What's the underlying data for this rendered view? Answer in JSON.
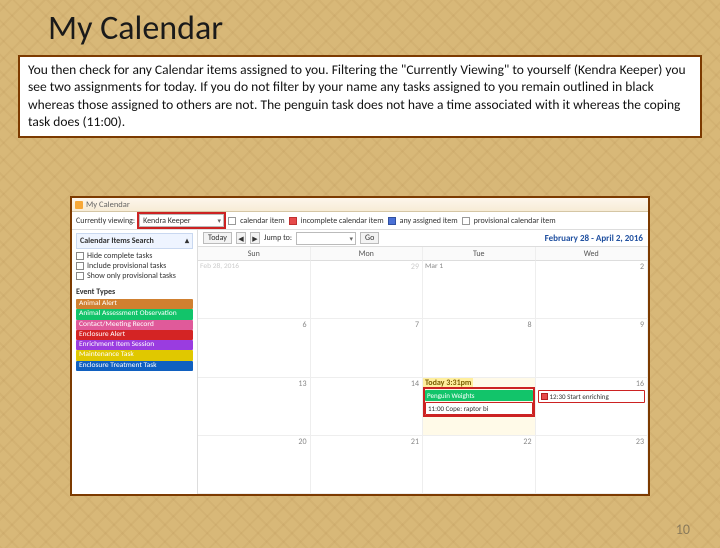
{
  "page": {
    "title": "My Calendar",
    "description": "You then check for any Calendar items assigned to you. Filtering the \"Currently Viewing\" to yourself (Kendra Keeper) you see two assignments for today. If you do not filter by your name any tasks assigned to you remain outlined in black whereas those assigned to others are not. The penguin task does not have a time associated with it whereas the coping task does (11:00).",
    "page_number": "10"
  },
  "app": {
    "window_title": "My Calendar",
    "toolbar": {
      "viewing_label": "Currently viewing:",
      "viewing_value": "Kendra Keeper",
      "legend": [
        {
          "label": "calendar item"
        },
        {
          "label": "incomplete calendar item"
        },
        {
          "label": "any assigned item"
        },
        {
          "label": "provisional calendar item"
        }
      ]
    },
    "controls": {
      "today": "Today",
      "jump_to": "Jump to:",
      "go": "Go",
      "date_range": "February 28 - April 2, 2016"
    },
    "sidebar": {
      "header": "Calendar Items Search",
      "checks": [
        "Hide complete tasks",
        "Include provisional tasks",
        "Show only provisional tasks"
      ],
      "event_types_label": "Event Types",
      "event_types": [
        {
          "label": "Animal Alert",
          "color": "#d08030"
        },
        {
          "label": "Animal Assessment Observation",
          "color": "#12c46a"
        },
        {
          "label": "Contact/Meeting Record",
          "color": "#e05a9a"
        },
        {
          "label": "Enclosure Alert",
          "color": "#d42424"
        },
        {
          "label": "Enrichment Item Session",
          "color": "#9a3ce0"
        },
        {
          "label": "Maintenance Task",
          "color": "#e0c800"
        },
        {
          "label": "Enclosure Treatment Task",
          "color": "#1060c0"
        }
      ]
    },
    "calendar": {
      "day_headers": [
        "Sun",
        "Mon",
        "Tue",
        "Wed"
      ],
      "rows": [
        {
          "cells": [
            {
              "label": "Feb 28, 2016",
              "num": "",
              "fade": true
            },
            {
              "num": "29",
              "fade": true
            },
            {
              "label": "Mar 1",
              "num": ""
            },
            {
              "num": "2"
            }
          ]
        },
        {
          "cells": [
            {
              "num": "6"
            },
            {
              "num": "7"
            },
            {
              "num": "8"
            },
            {
              "num": "9"
            }
          ]
        },
        {
          "cells": [
            {
              "num": "13"
            },
            {
              "num": "14"
            },
            {
              "today": true,
              "today_label": "Today 3:31pm",
              "num": "",
              "tasks": [
                {
                  "text": "Penguin Weights",
                  "bg": "#12c46a",
                  "fg": "#fff",
                  "outline": true
                },
                {
                  "text": "11:00 Cope: raptor bi",
                  "bg": "#ffffff",
                  "fg": "#333",
                  "border": "#c22",
                  "outline": true
                }
              ]
            },
            {
              "num": "16",
              "tasks": [
                {
                  "text": "12:30 Start enriching",
                  "bg": "#ffffff",
                  "fg": "#333",
                  "border": "#c22"
                }
              ]
            }
          ]
        },
        {
          "cells": [
            {
              "num": "20"
            },
            {
              "num": "21"
            },
            {
              "num": "22"
            },
            {
              "num": "23"
            }
          ]
        }
      ]
    }
  }
}
